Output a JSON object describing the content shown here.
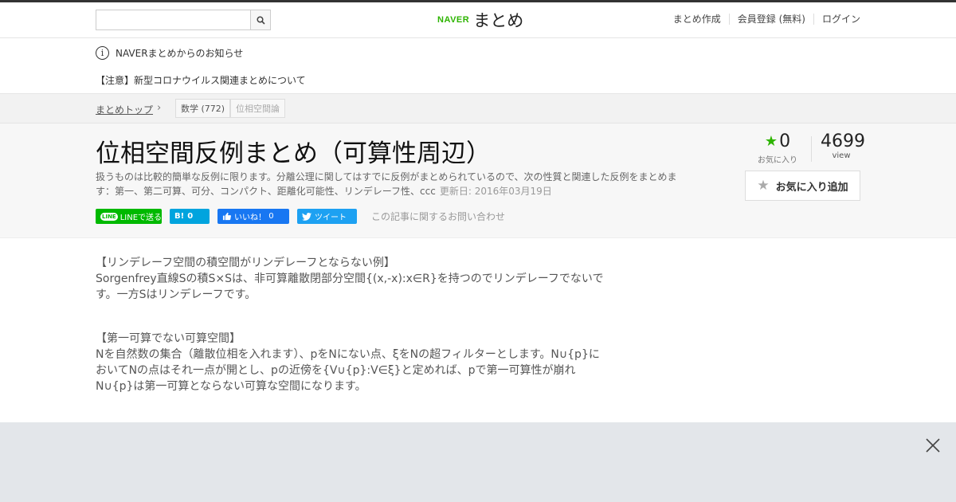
{
  "header": {
    "search_placeholder": "",
    "logo_naver": "NAVER",
    "logo_matome": "まとめ",
    "nav": [
      "まとめ作成",
      "会員登録 (無料)",
      "ログイン"
    ]
  },
  "notice": {
    "heading": "NAVERまとめからのお知らせ",
    "item": "【注意】新型コロナウイルス関連まとめについて"
  },
  "breadcrumb": {
    "top": "まとめトップ",
    "tags": [
      {
        "label": "数学",
        "count": "(772)"
      },
      {
        "label": "位相空間論"
      }
    ]
  },
  "article": {
    "title": "位相空間反例まとめ（可算性周辺）",
    "description": "扱うものは比較的簡単な反例に限ります。分離公理に関してはすでに反例がまとめられているので、次の性質と関連した反例をまとめます：第一、第二可算、可分、コンパクト、距離化可能性、リンデレーフ性、ccc",
    "updated": "更新日: 2016年03月19日",
    "favorites_count": "0",
    "favorites_label": "お気に入り",
    "views_count": "4699",
    "views_label": "view",
    "fav_button": "お気に入り追加",
    "share": {
      "line": "LINEで送る",
      "hatena_icon": "B!",
      "hatena_count": "0",
      "fb": "いいね！",
      "fb_count": "0",
      "tweet": "ツイート"
    },
    "contact": "この記事に関するお問い合わせ"
  },
  "content": [
    {
      "heading": "【リンデレーフ空間の積空間がリンデレーフとならない例】",
      "body": "Sorgenfrey直線Sの積S×Sは、非可算離散閉部分空間{(x,-x):x∈R}を持つのでリンデレーフでないです。一方Sはリンデレーフです。"
    },
    {
      "heading": "【第一可算でない可算空間】",
      "body": "Nを自然数の集合（離散位相を入れます）、pをNにない点、ξをNの超フィルターとします。N∪{p}においてNの点はそれ一点が開とし、pの近傍を{V∪{p}:V∈ξ}と定めれば、pで第一可算性が崩れN∪{p}は第一可算とならない可算な空間になります。"
    }
  ],
  "colors": {
    "naver_green": "#2db400",
    "line_green": "#00b900",
    "hatena_blue": "#00a4de",
    "fb_blue": "#1877f2",
    "twitter_blue": "#1da1f2"
  }
}
